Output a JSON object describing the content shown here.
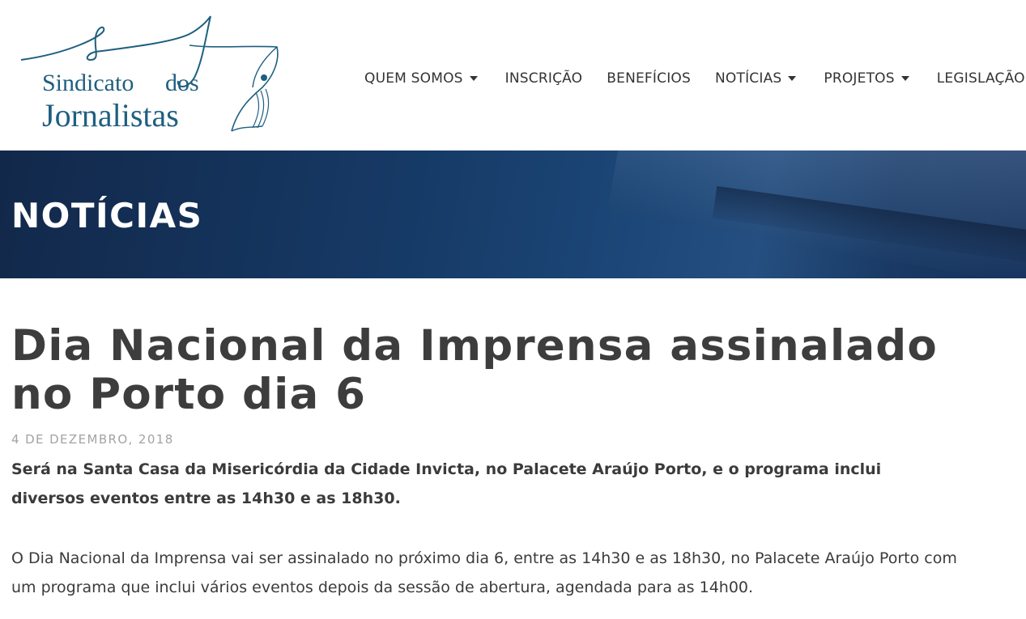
{
  "logo": {
    "line1": "Sindicato",
    "line1b": "dos",
    "line2": "Jornalistas",
    "color": "#1f5f80"
  },
  "nav": {
    "items": [
      {
        "label": "QUEM SOMOS",
        "dropdown": true
      },
      {
        "label": "INSCRIÇÃO",
        "dropdown": false
      },
      {
        "label": "BENEFÍCIOS",
        "dropdown": false
      },
      {
        "label": "NOTÍCIAS",
        "dropdown": true
      },
      {
        "label": "PROJETOS",
        "dropdown": true
      },
      {
        "label": "LEGISLAÇÃO",
        "dropdown": false
      }
    ]
  },
  "hero": {
    "title": "NOTÍCIAS",
    "color": "#163a66"
  },
  "article": {
    "title": "Dia Nacional da Imprensa assinalado no Porto dia 6",
    "date": "4 DE DEZEMBRO, 2018",
    "lead": "Será na Santa Casa da Misericórdia da Cidade Invicta, no Palacete Araújo Porto, e o programa inclui diversos eventos entre as 14h30 e as 18h30.",
    "body": "O Dia Nacional da Imprensa vai ser assinalado no próximo dia 6, entre as 14h30 e as 18h30, no Palacete Araújo Porto com um programa que inclui vários eventos depois da sessão de abertura, agendada para as 14h00."
  }
}
